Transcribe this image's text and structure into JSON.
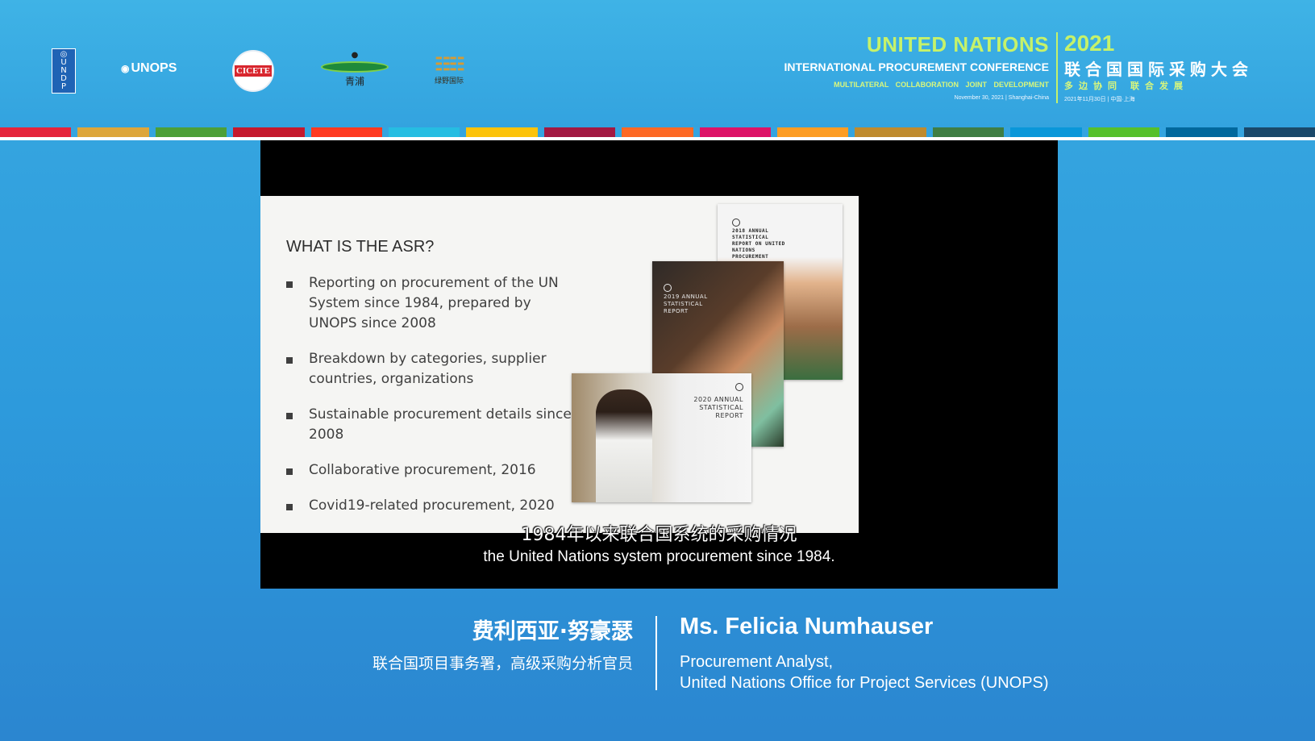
{
  "header": {
    "logos": {
      "undp_text": "U N D P",
      "unops_text": "UNOPS",
      "cicete_text": "CICETE",
      "qingpu_text": "青浦",
      "lu_text": "绿野国际"
    },
    "conference": {
      "title_en": "UNITED NATIONS",
      "subtitle_en": "INTERNATIONAL PROCUREMENT CONFERENCE",
      "tagline_en": "MULTILATERAL COLLABORATION   JOINT DEVELOPMENT",
      "date_en": "November 30, 2021 | Shanghai-China",
      "year": "2021",
      "title_cn": "联合国国际采购大会",
      "tagline_cn": "多边协同 联合发展",
      "date_cn": "2021年11月30日 | 中国·上海"
    },
    "sdg_colors": [
      "#e5243b",
      "#dda63a",
      "#4c9f38",
      "#c5192d",
      "#ff3a21",
      "#26bde2",
      "#fcc30b",
      "#a21942",
      "#fd6925",
      "#dd1367",
      "#fd9d24",
      "#bf8b2e",
      "#3f7e44",
      "#0a97d9",
      "#56c02b",
      "#00689d",
      "#19486a"
    ]
  },
  "slide": {
    "title": "WHAT IS THE ASR?",
    "bullets": [
      "Reporting on procurement of the UN System since 1984, prepared by UNOPS since 2008",
      "Breakdown by categories, supplier countries, organizations",
      "Sustainable procurement details since 2008",
      "Collaborative procurement, 2016",
      "Covid19-related procurement, 2020"
    ],
    "reports": [
      {
        "title": "2018 ANNUAL STATISTICAL REPORT ON UNITED NATIONS PROCUREMENT"
      },
      {
        "title": "2019 ANNUAL STATISTICAL REPORT"
      },
      {
        "title": "2020 ANNUAL STATISTICAL REPORT"
      }
    ]
  },
  "subtitles": {
    "cn": "1984年以来联合国系统的采购情况",
    "en": "the United Nations system procurement since 1984."
  },
  "speaker": {
    "name_cn": "费利西亚·努豪瑟",
    "role_cn": "联合国项目事务署，高级采购分析官员",
    "name_en": "Ms. Felicia Numhauser",
    "role_en_line1": "Procurement Analyst,",
    "role_en_line2": "United Nations Office for Project Services (UNOPS)"
  }
}
